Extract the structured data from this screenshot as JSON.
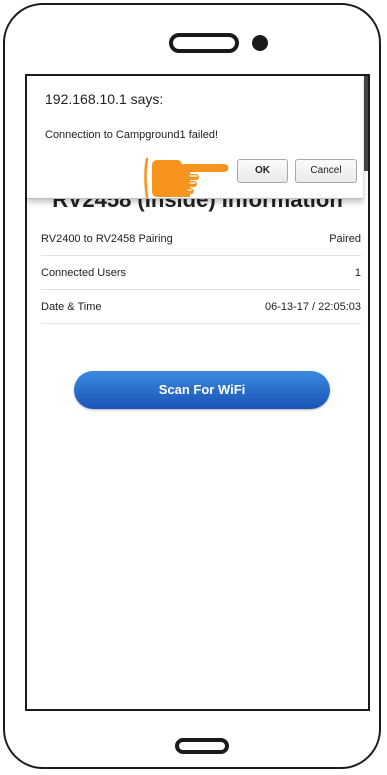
{
  "dialog": {
    "origin": "192.168.10.1 says:",
    "message": "Connection to Campground1 failed!",
    "ok_label": "OK",
    "cancel_label": "Cancel"
  },
  "page": {
    "heading": "RV2458 (Inside) Information",
    "rows": [
      {
        "label": "RV2400 to RV2458 Pairing",
        "value": "Paired"
      },
      {
        "label": "Connected Users",
        "value": "1"
      },
      {
        "label": "Date & Time",
        "value": "06-13-17 / 22:05:03"
      }
    ],
    "scan_button_label": "Scan For WiFi"
  },
  "icons": {
    "pointer": "pointing-hand-icon",
    "camera": "camera-icon",
    "speaker": "speaker-icon",
    "home": "home-button"
  },
  "colors": {
    "pointer_hand": "#f7941d",
    "scan_button": "#1f5fc2",
    "device_frame": "#1a1a1a"
  }
}
